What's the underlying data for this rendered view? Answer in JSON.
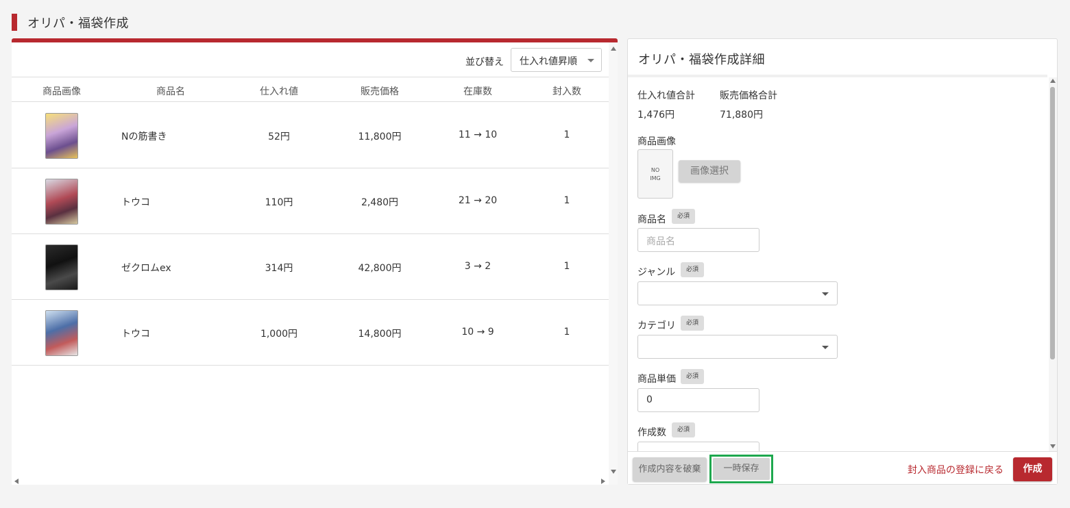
{
  "page": {
    "title": "オリパ・福袋作成"
  },
  "colors": {
    "accent": "#b8292f",
    "highlight_border": "#1ea84e",
    "disabled_button": "#d4d4d4"
  },
  "sort": {
    "label": "並び替え",
    "selected": "仕入れ値昇順"
  },
  "table": {
    "headers": [
      "商品画像",
      "商品名",
      "仕入れ値",
      "販売価格",
      "在庫数",
      "封入数"
    ],
    "rows": [
      {
        "name": "Nの筋書き",
        "cost": "52円",
        "price": "11,800円",
        "stock": "11 → 10",
        "qty": "1"
      },
      {
        "name": "トウコ",
        "cost": "110円",
        "price": "2,480円",
        "stock": "21 → 20",
        "qty": "1"
      },
      {
        "name": "ゼクロムex",
        "cost": "314円",
        "price": "42,800円",
        "stock": "3 → 2",
        "qty": "1"
      },
      {
        "name": "トウコ",
        "cost": "1,000円",
        "price": "14,800円",
        "stock": "10 → 9",
        "qty": "1"
      }
    ]
  },
  "detail": {
    "title": "オリパ・福袋作成詳細",
    "cost_total_label": "仕入れ値合計",
    "cost_total_value": "1,476円",
    "price_total_label": "販売価格合計",
    "price_total_value": "71,880円",
    "image_label": "商品画像",
    "no_image_line1": "NO",
    "no_image_line2": "IMG",
    "image_select_button": "画像選択",
    "required_badge": "必須",
    "product_name_label": "商品名",
    "product_name_placeholder": "商品名",
    "genre_label": "ジャンル",
    "category_label": "カテゴリ",
    "unit_price_label": "商品単価",
    "unit_price_value": "0",
    "create_count_label": "作成数"
  },
  "footer": {
    "discard_button": "作成内容を破棄",
    "temp_save_button": "一時保存",
    "back_link": "封入商品の登録に戻る",
    "create_button": "作成"
  },
  "icons": {
    "header_marker": "red-vertical-bar",
    "sort_caret": "chevron-down-icon",
    "scroll_arrows": [
      "arrow-up-icon",
      "arrow-down-icon",
      "arrow-left-icon",
      "arrow-right-icon"
    ]
  }
}
